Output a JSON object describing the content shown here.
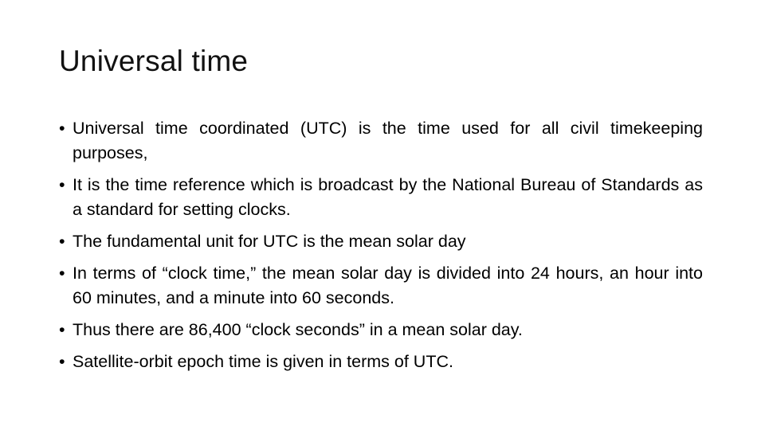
{
  "slide": {
    "title": "Universal time",
    "bullet_glyph": "•",
    "bullets": [
      {
        "text": "Universal time coordinated (UTC) is the time used for all civil timekeeping purposes,"
      },
      {
        "text": "It is the time reference which is broadcast by the National Bureau of Standards as a standard for setting clocks."
      },
      {
        "text": "The fundamental unit for UTC is the mean solar day"
      },
      {
        "text": "In terms of “clock time,” the mean solar day is divided into 24 hours, an hour into 60 minutes, and a minute into 60 seconds."
      },
      {
        "text": "Thus there are 86,400 “clock seconds” in a mean solar day."
      },
      {
        "text": "Satellite-orbit epoch time is given in terms of UTC."
      }
    ]
  }
}
